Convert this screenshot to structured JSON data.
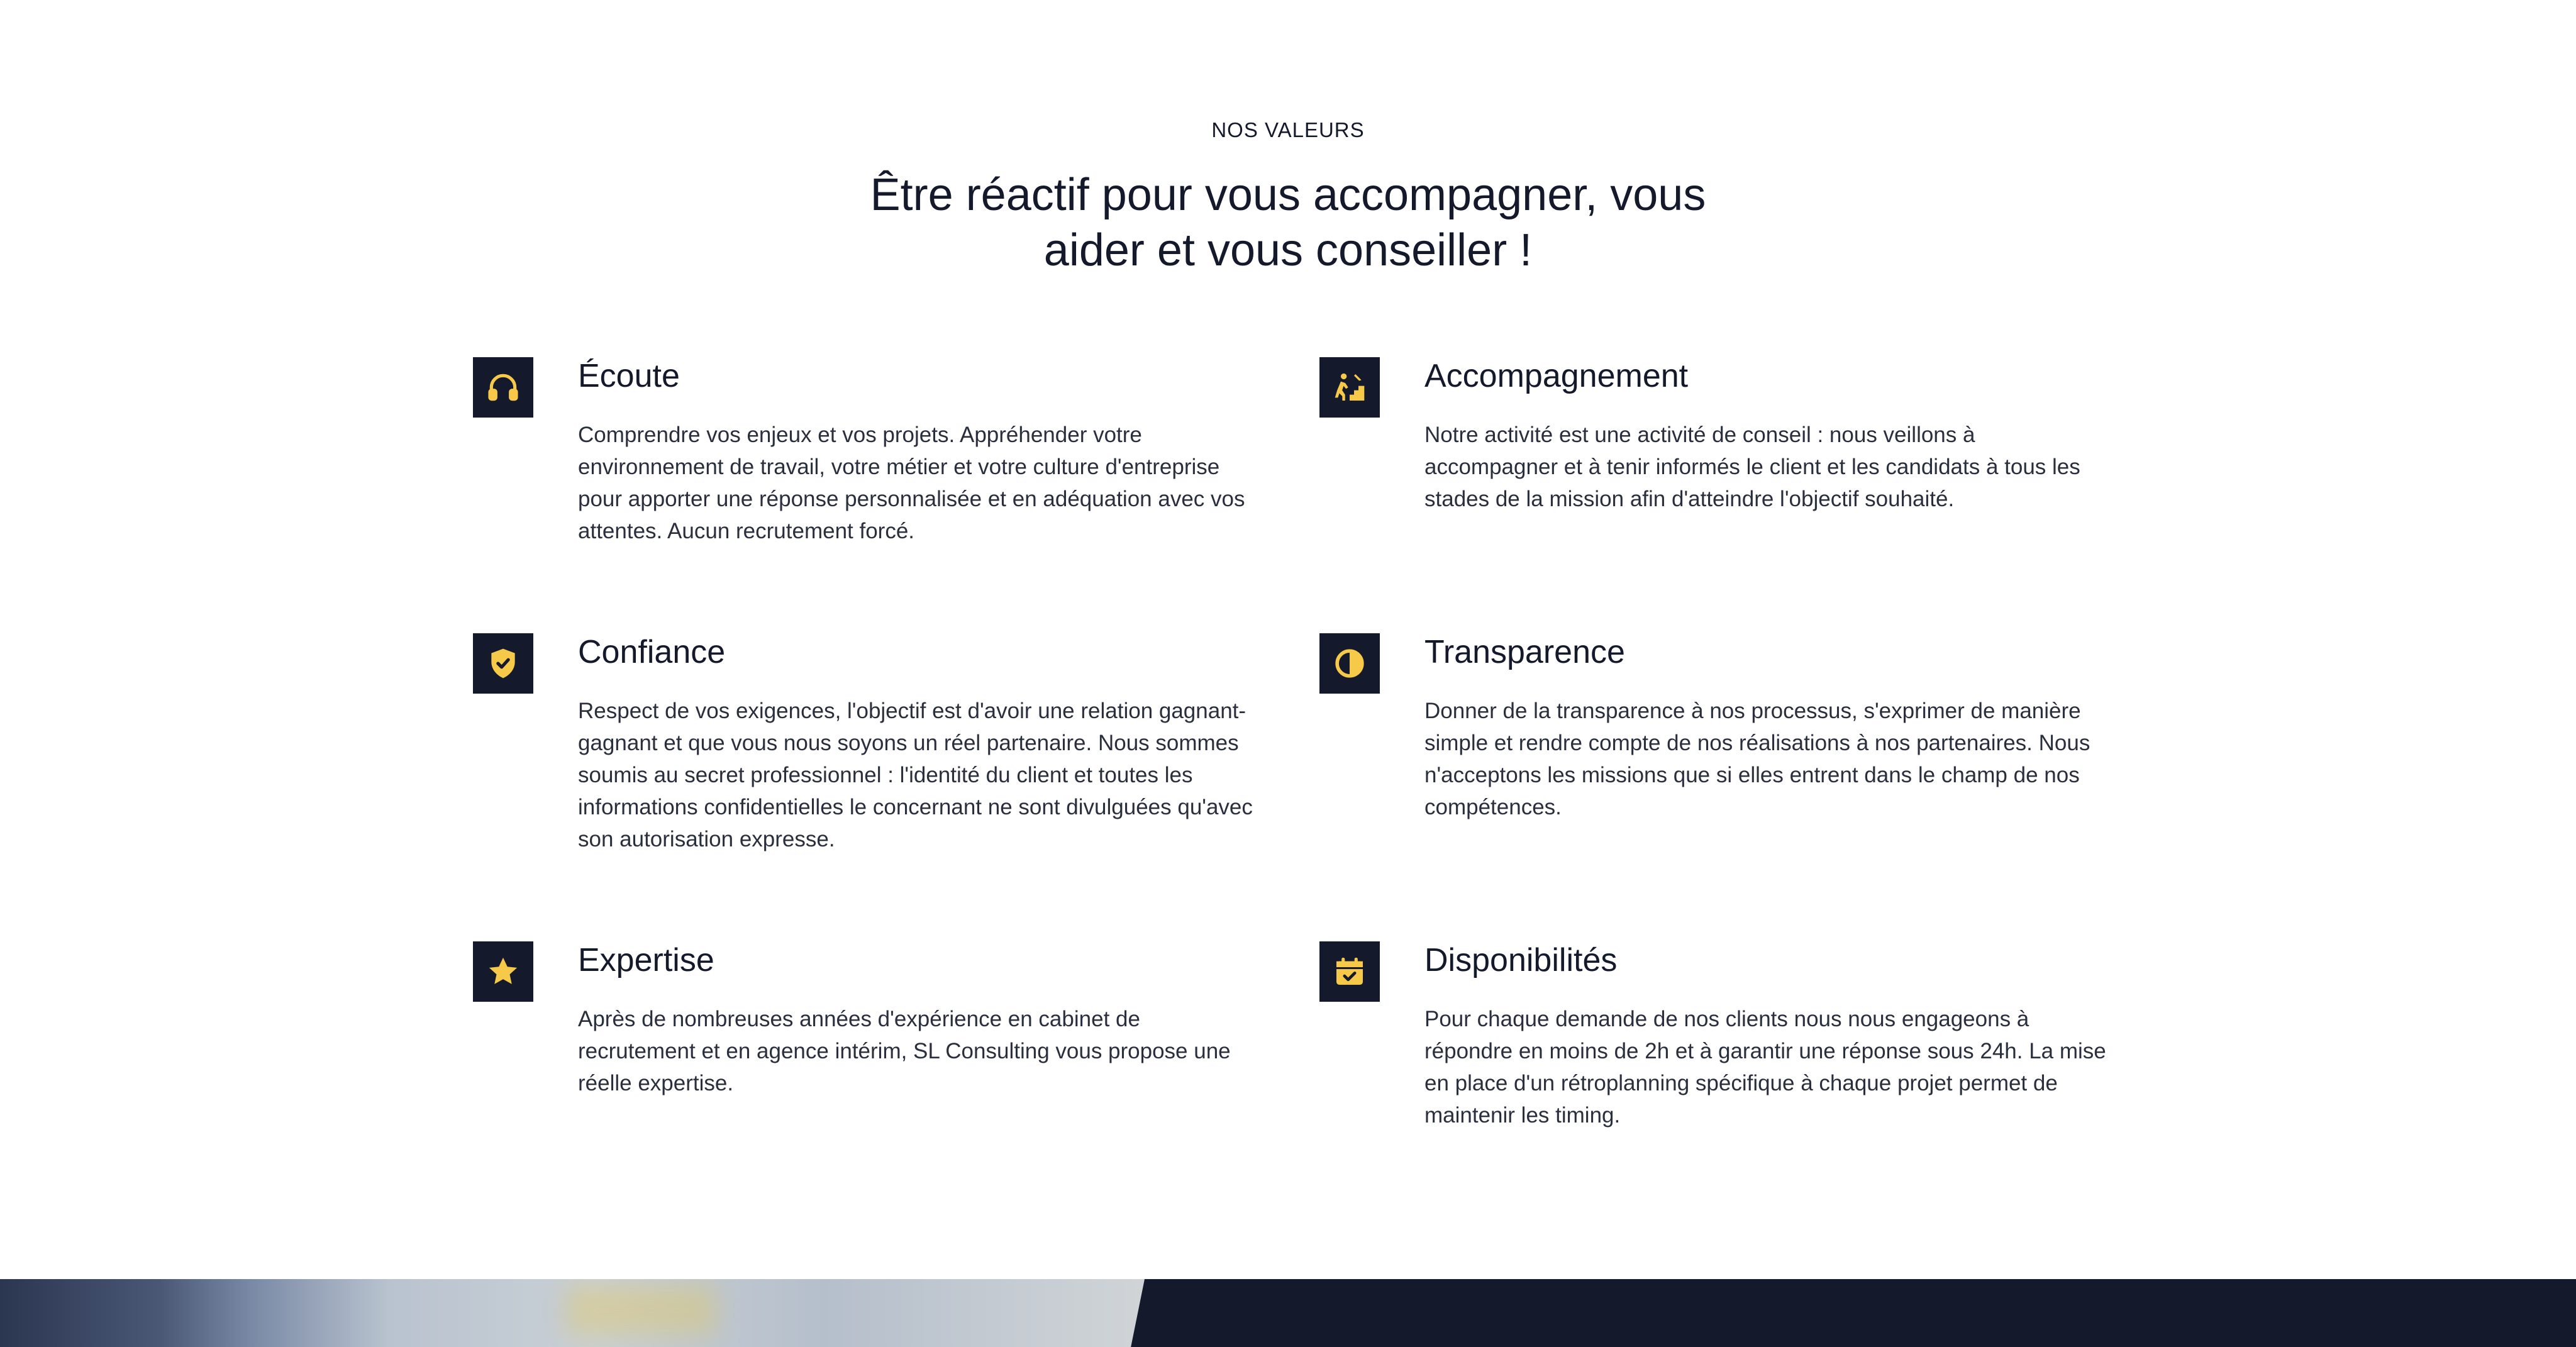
{
  "section": {
    "eyebrow": "NOS VALEURS",
    "headline_line1": "Être réactif pour vous accompagner, vous",
    "headline_line2": "aider et vous conseiller !"
  },
  "colors": {
    "accent": "#f7c948",
    "dark": "#141a2c",
    "text": "#2a2f3d"
  },
  "values": [
    {
      "icon": "headphones-icon",
      "title": "Écoute",
      "description": "Comprendre vos enjeux et vos projets. Appréhender votre environnement de travail, votre métier et votre culture d'entreprise pour apporter une réponse personnalisée et en adéquation avec vos attentes. Aucun recrutement forcé."
    },
    {
      "icon": "person-stairs-icon",
      "title": "Accompagnement",
      "description": "Notre activité est une activité de conseil : nous veillons à accompagner et à tenir informés le client et les candidats à tous les stades de la mission afin d'atteindre l'objectif souhaité."
    },
    {
      "icon": "shield-check-icon",
      "title": "Confiance",
      "description": "Respect de vos exigences, l'objectif est d'avoir une relation gagnant-gagnant et que vous nous soyons un réel partenaire. Nous sommes soumis au secret professionnel : l'identité du client et toutes les informations confidentielles le concernant ne sont divulguées qu'avec son autorisation expresse."
    },
    {
      "icon": "half-circle-icon",
      "title": "Transparence",
      "description": "Donner de la transparence à nos processus, s'exprimer de manière simple et rendre compte de nos réalisations à nos partenaires. Nous n'acceptons les missions que si elles entrent dans le champ de nos compétences."
    },
    {
      "icon": "star-icon",
      "title": "Expertise",
      "description": "Après de nombreuses années d'expérience en cabinet de recrutement et en agence intérim, SL Consulting vous propose une réelle expertise."
    },
    {
      "icon": "calendar-check-icon",
      "title": "Disponibilités",
      "description": "Pour chaque demande de nos clients nous nous engageons à répondre en moins de 2h et à garantir une réponse sous 24h. La mise en place d'un rétroplanning spécifique à chaque projet permet de maintenir les timing."
    }
  ]
}
